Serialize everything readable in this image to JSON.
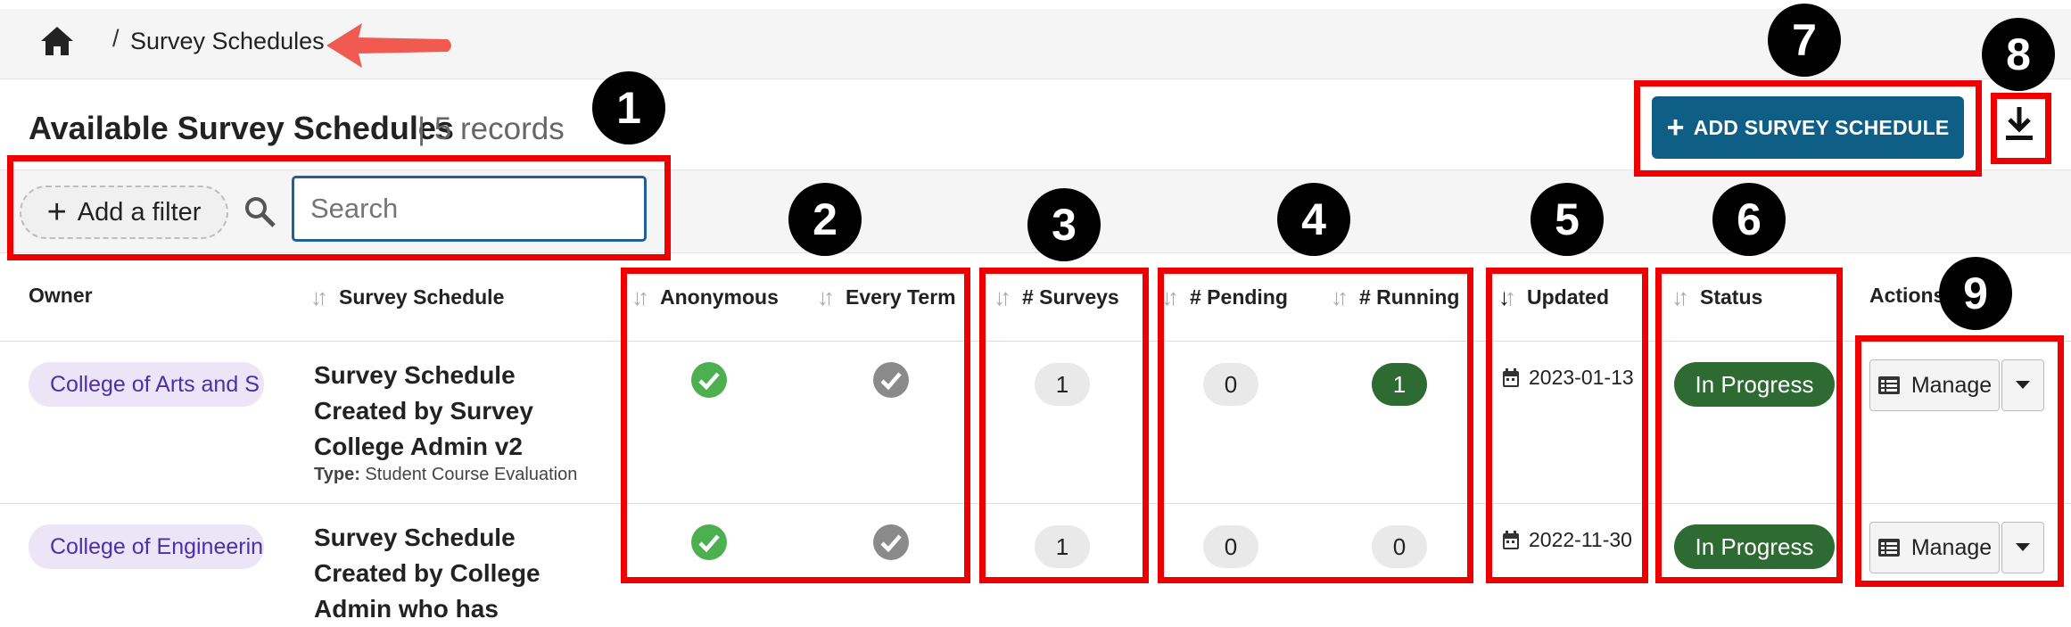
{
  "breadcrumb": {
    "separator": "/",
    "current": "Survey Schedules"
  },
  "header": {
    "title": "Available Survey Schedules",
    "records": "| 5 records",
    "add_button": "ADD SURVEY SCHEDULE",
    "add_button_color": "#0e5e86"
  },
  "filters": {
    "add_filter": "Add a filter",
    "search_placeholder": "Search"
  },
  "table": {
    "columns": {
      "owner": "Owner",
      "schedule": "Survey Schedule",
      "anonymous": "Anonymous",
      "every_term": "Every Term",
      "surveys": "# Surveys",
      "pending": "# Pending",
      "running": "# Running",
      "updated": "Updated",
      "status": "Status",
      "actions": "Actions"
    },
    "rows": [
      {
        "owner": "College of Arts and S",
        "schedule_l1": "Survey Schedule",
        "schedule_l2": "Created by Survey",
        "schedule_l3": "College Admin v2",
        "type_label": "Type:",
        "type_value": "Student Course Evaluation",
        "anonymous": "check-green",
        "every_term": "check-gray",
        "surveys": "1",
        "pending": "0",
        "running": "1",
        "updated": "2023-01-13",
        "status": "In Progress",
        "action": "Manage"
      },
      {
        "owner": "College of Engineerin",
        "schedule_l1": "Survey Schedule",
        "schedule_l2": "Created by College",
        "schedule_l3": "Admin who has",
        "anonymous": "check-green",
        "every_term": "check-gray",
        "surveys": "1",
        "pending": "0",
        "running": "0",
        "updated": "2022-11-30",
        "status": "In Progress",
        "action": "Manage"
      }
    ]
  },
  "annotations": [
    "1",
    "2",
    "3",
    "4",
    "5",
    "6",
    "7",
    "8",
    "9"
  ],
  "colors": {
    "annotation_red": "#ee0000",
    "status_green": "#2e6b33",
    "owner_pill": "#ebe5f7",
    "check_green": "#4caf50",
    "check_gray": "#8a8a8a"
  }
}
